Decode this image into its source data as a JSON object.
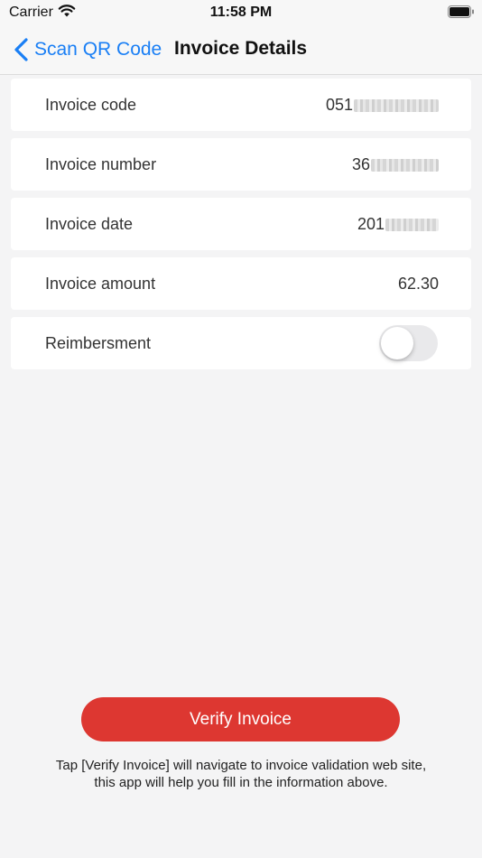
{
  "status_bar": {
    "carrier": "Carrier",
    "time": "11:58 PM",
    "icons": [
      "wifi-icon",
      "battery-icon"
    ]
  },
  "nav": {
    "back_label": "Scan QR Code",
    "title": "Invoice Details",
    "accent_color": "#1a7ff5"
  },
  "rows": [
    {
      "label": "Invoice code",
      "value_visible": "051"
    },
    {
      "label": "Invoice number",
      "value_visible": "36"
    },
    {
      "label": "Invoice date",
      "value_visible": "201"
    },
    {
      "label": "Invoice amount",
      "value_visible": "62.30"
    },
    {
      "label": "Reimbersment",
      "toggle_on": false
    }
  ],
  "verify_button": {
    "label": "Verify Invoice",
    "color": "#dd3731"
  },
  "hint": {
    "line1": "Tap [Verify Invoice] will navigate to invoice validation web site,",
    "line2": "this app will help you fill in the information above."
  }
}
